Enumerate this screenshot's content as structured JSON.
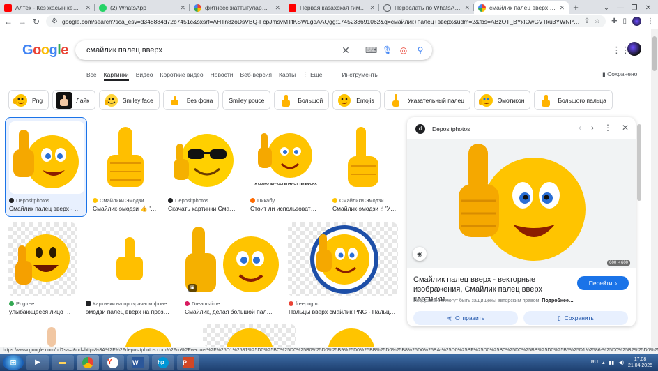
{
  "tabs": [
    {
      "title": "Алтек - Кез жасын кемеңтеспе…",
      "color": "#ff0000",
      "active": false
    },
    {
      "title": "(2) WhatsApp",
      "color": "#25d366",
      "active": false
    },
    {
      "title": "фитнесс жаттығулары - Поиск…",
      "color": "#4285f4",
      "active": false
    },
    {
      "title": "Первая казахская гимнастика…",
      "color": "#ff0000",
      "active": false
    },
    {
      "title": "Переслать по WhatsApp",
      "color": "#5f6368",
      "active": false
    },
    {
      "title": "смайлик палец вверх - Поиск…",
      "color": "#4285f4",
      "active": true
    }
  ],
  "address": {
    "url": "google.com/search?sca_esv=d348884d72b7451c&sxsrf=AHTn8zoDsVBQ-FcpJmsvMTfKSWLgdAAQgg:1745233691062&q=смайлик+палец+вверх&udm=2&fbs=ABzOT_BYxlOwGVTku3YWNPvW5AUx…"
  },
  "search": {
    "query": "смайлик палец вверх"
  },
  "filters": {
    "all": "Все",
    "images": "Картинки",
    "video": "Видео",
    "short_video": "Короткие видео",
    "news": "Новости",
    "web": "Веб-версия",
    "maps": "Карты",
    "more": "⋮ Ещё",
    "tools": "Инструменты",
    "saved": "Сохранено"
  },
  "chips": [
    "Png",
    "Лайк",
    "Smiley face",
    "Без фона",
    "Smiley pouce",
    "Большой",
    "Emojis",
    "Указательный палец",
    "Эмотикон",
    "Большого пальца"
  ],
  "results": [
    {
      "source": "Depositphotos",
      "caption": "Смайлик палец вверх - …"
    },
    {
      "source": "Смайлики Эмодзи",
      "caption": "Смайлик-эмодзи 👍 '…"
    },
    {
      "source": "Depositphotos",
      "caption": "Скачать картинки Сма…"
    },
    {
      "source": "Пикабу",
      "caption": "Стоит ли использоват…",
      "overlay": "Я СКОРО БЛ** ОСЛЕПНУ ОТ ТЕЛЕФОНА"
    },
    {
      "source": "Смайлики Эмодзи",
      "caption": "Смайлик-эмодзи ☝ 'У…"
    },
    {
      "source": "Pngtree",
      "caption": "улыбающееся лицо …"
    },
    {
      "source": "Картинки на прозрачном фоне…",
      "caption": "эмодзи палец вверх на проз…"
    },
    {
      "source": "Dreamstime",
      "caption": "Смайлик, делая большой пал…"
    },
    {
      "source": "freepng.ru",
      "caption": "Пальцы вверх смайлик PNG - Пальц…"
    }
  ],
  "panel": {
    "source": "Depositphotos",
    "dimensions": "600 × 600",
    "title": "Смайлик палец вверх - векторные изображения, Смайлик палец вверх картинки…",
    "visit": "Перейти",
    "copyright": "Изображения могут быть защищены авторским правом.",
    "more": "Подробнее…",
    "share": "Отправить",
    "save": "Сохранить"
  },
  "statusbar": {
    "text": "https://www.google.com/url?sa=i&url=https%3A%2F%2Fdepositphotos.com%2Fru%2Fvectors%2F%25D1%2581%25D0%25BC%25D0%25B0%25D0%25B9%25D0%25BB%25D0%25B8%25D0%25BA-%25D0%25BF%25D0%25B0%25D0%25BB%25D0%25B5%25D1%2586-%25D0%25B2%25D0%25B2%25D0%25B5%25D1%2580%25D1%2585…"
  },
  "taskbar": {
    "lang": "RU",
    "time": "17:08",
    "date": "21.04.2025"
  },
  "colors": {
    "accent": "#1a73e8",
    "emoji": "#ffc400"
  }
}
